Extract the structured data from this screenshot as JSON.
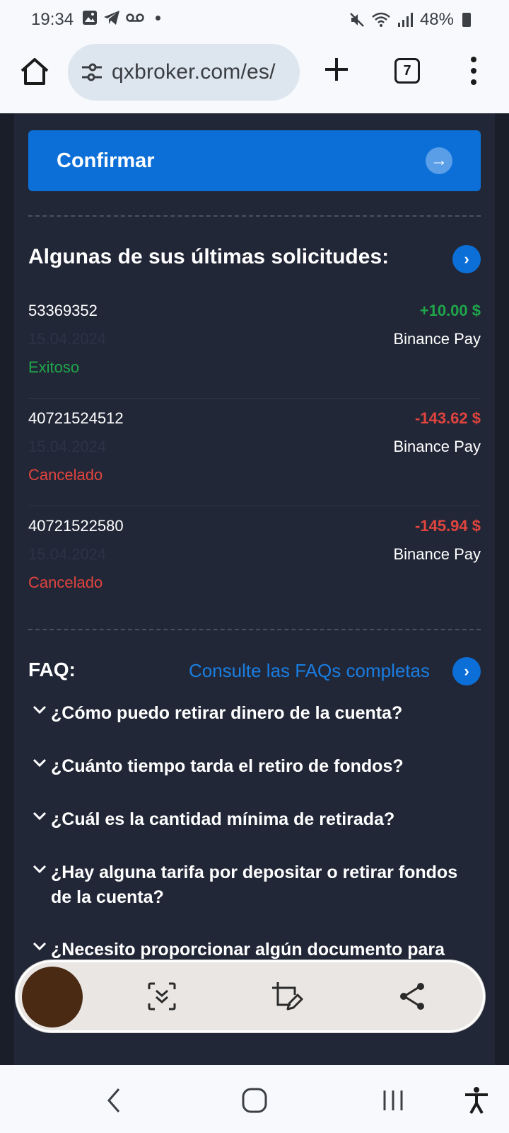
{
  "status_bar": {
    "time": "19:34",
    "battery": "48%"
  },
  "browser": {
    "url": "qxbroker.com/es/",
    "tab_count": "7"
  },
  "withdraw": {
    "confirm_label": "Confirmar"
  },
  "requests": {
    "title": "Algunas de sus últimas solicitudes:",
    "items": [
      {
        "id": "53369352",
        "date": "15.04.2024",
        "status": "Exitoso",
        "amount": "+10.00 $",
        "method": "Binance Pay"
      },
      {
        "id": "40721524512",
        "date": "15.04.2024",
        "status": "Cancelado",
        "amount": "-143.62 $",
        "method": "Binance Pay"
      },
      {
        "id": "40721522580",
        "date": "15.04.2024",
        "status": "Cancelado",
        "amount": "-145.94 $",
        "method": "Binance Pay"
      }
    ]
  },
  "faq": {
    "title": "FAQ:",
    "link_label": "Consulte las FAQs completas",
    "items": [
      "¿Cómo puedo retirar dinero de la cuenta?",
      "¿Cuánto tiempo tarda el retiro de fondos?",
      "¿Cuál es la cantidad mínima de retirada?",
      "¿Hay alguna tarifa por depositar o retirar fondos de la cuenta?",
      "¿Necesito proporcionar algún documento para realizar un retiro?"
    ]
  },
  "colors": {
    "success": "#1fa64a",
    "cancel": "#e0443e",
    "accent": "#0c6fd8"
  },
  "icons": {
    "home": "home-icon",
    "site_settings": "tune-icon",
    "new_tab": "plus-icon",
    "menu": "more-vert-icon",
    "scroll_capture": "scroll-capture-icon",
    "edit": "crop-edit-icon",
    "share": "share-icon"
  }
}
